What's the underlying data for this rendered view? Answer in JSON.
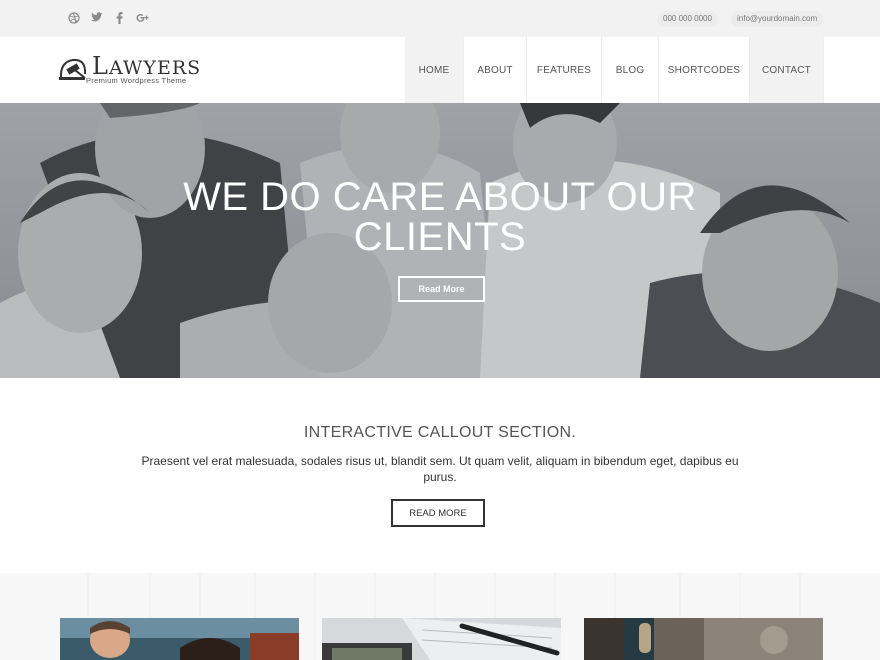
{
  "topbar": {
    "social_icons": [
      "dribbble-icon",
      "twitter-icon",
      "facebook-icon",
      "google-plus-icon"
    ],
    "phone": "000 000 0000",
    "email": "info@yourdomain.com"
  },
  "header": {
    "logo_name": "AWYERS",
    "logo_initial": "L",
    "logo_tagline": "Premium Wordpress Theme",
    "nav": [
      {
        "label": "HOME",
        "active": true
      },
      {
        "label": "ABOUT",
        "active": false
      },
      {
        "label": "FEATURES",
        "active": false
      },
      {
        "label": "BLOG",
        "active": false
      },
      {
        "label": "SHORTCODES",
        "active": false
      },
      {
        "label": "CONTACT",
        "active": true
      }
    ]
  },
  "hero": {
    "title_line1": "WE DO CARE ABOUT OUR",
    "title_line2": "CLIENTS",
    "button_label": "Read More"
  },
  "callout": {
    "title": "INTERACTIVE CALLOUT SECTION.",
    "text": "Praesent vel erat malesuada, sodales risus ut, blandit sem. Ut quam velit, aliquam in bibendum eget, dapibus eu purus.",
    "button_label": "READ MORE"
  },
  "colors": {
    "topbar_bg": "#f2f2f2",
    "nav_active_bg": "#f2f2f2",
    "hero_overlay": "#8d8f95",
    "text_dark": "#333333"
  }
}
